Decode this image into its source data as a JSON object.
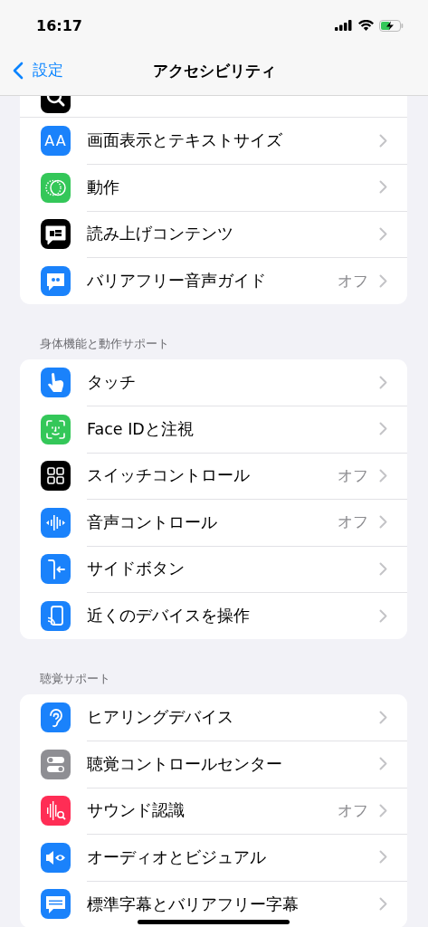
{
  "status_bar": {
    "time": "16:17"
  },
  "nav": {
    "back": "設定",
    "title": "アクセシビリティ"
  },
  "groups": [
    {
      "cut_row": {
        "kind": "zoom"
      },
      "rows": [
        {
          "kind": "text-size",
          "glyph": "AA",
          "label": "画面表示とテキストサイズ"
        },
        {
          "kind": "motion",
          "label": "動作"
        },
        {
          "kind": "spoken",
          "label": "読み上げコンテンツ"
        },
        {
          "kind": "audio-desc",
          "label": "バリアフリー音声ガイド",
          "value": "オフ"
        }
      ]
    },
    {
      "header": "身体機能と動作サポート",
      "rows": [
        {
          "kind": "touch",
          "label": "タッチ"
        },
        {
          "kind": "face",
          "label": "Face IDと注視"
        },
        {
          "kind": "switch",
          "label": "スイッチコントロール",
          "value": "オフ"
        },
        {
          "kind": "voice",
          "label": "音声コントロール",
          "value": "オフ"
        },
        {
          "kind": "side",
          "label": "サイドボタン"
        },
        {
          "kind": "nearby",
          "label": "近くのデバイスを操作"
        }
      ]
    },
    {
      "header": "聴覚サポート",
      "rows": [
        {
          "kind": "ear",
          "label": "ヒアリングデバイス"
        },
        {
          "kind": "toggles",
          "label": "聴覚コントロールセンター"
        },
        {
          "kind": "sound",
          "label": "サウンド認識",
          "value": "オフ"
        },
        {
          "kind": "av",
          "label": "オーディオとビジュアル"
        },
        {
          "kind": "captions",
          "label": "標準字幕とバリアフリー字幕"
        }
      ]
    }
  ]
}
